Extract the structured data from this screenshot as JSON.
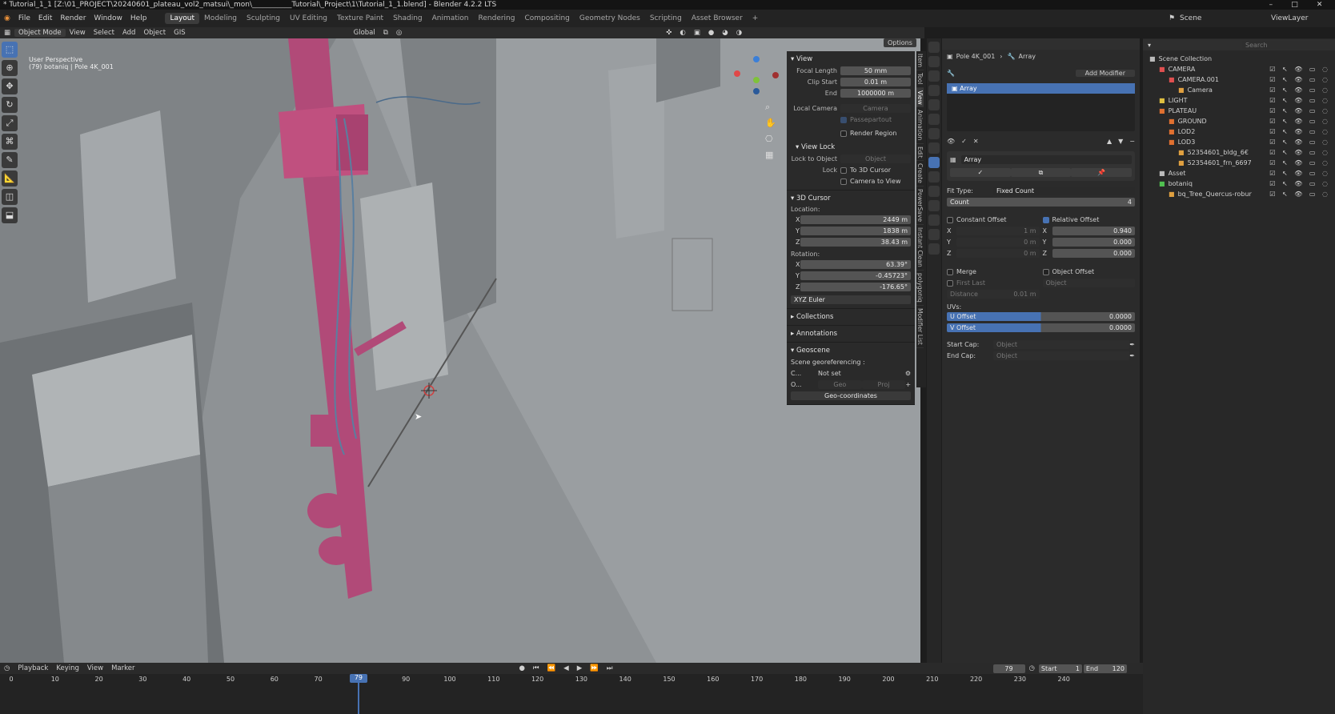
{
  "window": {
    "title": "* Tutorial_1_1 [Z:\\01_PROJECT\\20240601_plateau_vol2_matsui\\_mon\\___________Tutorial\\_Project\\1\\Tutorial_1_1.blend] - Blender 4.2.2 LTS"
  },
  "menu": [
    "File",
    "Edit",
    "Render",
    "Window",
    "Help"
  ],
  "workspaces": [
    {
      "label": "Layout",
      "active": true
    },
    {
      "label": "Modeling"
    },
    {
      "label": "Sculpting"
    },
    {
      "label": "UV Editing"
    },
    {
      "label": "Texture Paint"
    },
    {
      "label": "Shading"
    },
    {
      "label": "Animation"
    },
    {
      "label": "Rendering"
    },
    {
      "label": "Compositing"
    },
    {
      "label": "Geometry Nodes"
    },
    {
      "label": "Scripting"
    },
    {
      "label": "Asset Browser"
    },
    {
      "label": "+"
    }
  ],
  "scene": {
    "label": "Scene",
    "view_layer": "ViewLayer"
  },
  "vp_header": {
    "mode": "Object Mode",
    "view": "View",
    "select": "Select",
    "add": "Add",
    "object": "Object",
    "gis": "GIS",
    "transform": "Global",
    "options": "Options"
  },
  "viewport": {
    "line1": "User Perspective",
    "line2": "(79) botaniq | Pole 4K_001"
  },
  "tools": [
    "select",
    "cursor",
    "move",
    "rotate",
    "scale",
    "transform",
    "annotate",
    "measure",
    "add-cube",
    "extrude"
  ],
  "npanel": {
    "view": {
      "title": "View",
      "focal_label": "Focal Length",
      "focal": "50 mm",
      "clip_start_label": "Clip Start",
      "clip_start": "0.01 m",
      "end_label": "End",
      "end": "1000000 m",
      "local_camera_label": "Local Camera",
      "local_camera": "Camera",
      "passepartout": "Passepartout",
      "render_region": "Render Region"
    },
    "view_lock": {
      "title": "View Lock",
      "lock_to_object_label": "Lock to Object",
      "object_placeholder": "Object",
      "lock_label": "Lock",
      "to_3d_cursor": "To 3D Cursor",
      "camera_to_view": "Camera to View"
    },
    "cursor": {
      "title": "3D Cursor",
      "location_label": "Location:",
      "x": "2449 m",
      "y": "1838 m",
      "z": "38.43 m",
      "rotation_label": "Rotation:",
      "rx": "63.39°",
      "ry": "-0.45723°",
      "rz": "-176.65°",
      "mode": "XYZ Euler"
    },
    "collections": "Collections",
    "annotations": "Annotations",
    "geoscene": {
      "title": "Geoscene",
      "georef": "Scene georeferencing :",
      "c_label": "C...",
      "c_value": "Not set",
      "o_label": "O...",
      "geo": "Geo",
      "proj": "Proj",
      "geo_coords": "Geo-coordinates"
    }
  },
  "tabs": [
    "Item",
    "Tool",
    "View",
    "Animation",
    "Edit",
    "Create",
    "PowerSave",
    "Instant Clean",
    "polygoniq",
    "Modifier List"
  ],
  "properties": {
    "breadcrumb_obj": "Pole 4K_001",
    "breadcrumb_mod": "Array",
    "add_modifier": "Add Modifier",
    "stack_item": "Array",
    "mod_name": "Array",
    "fit_type_label": "Fit Type:",
    "fit_type": "Fixed Count",
    "count_label": "Count",
    "count": "4",
    "constant_offset": "Constant Offset",
    "cx": "1 m",
    "cy": "0 m",
    "cz": "0 m",
    "relative_offset": "Relative Offset",
    "rx": "0.940",
    "ry": "0.000",
    "rz": "0.000",
    "merge": "Merge",
    "first_last": "First Last",
    "distance_label": "Distance",
    "distance": "0.01 m",
    "object_offset": "Object Offset",
    "object_placeholder": "Object",
    "uvs_label": "UVs:",
    "u_offset_label": "U Offset",
    "u_offset": "0.0000",
    "v_offset_label": "V Offset",
    "v_offset": "0.0000",
    "start_cap_label": "Start Cap:",
    "end_cap_label": "End Cap:",
    "cap_placeholder": "Object"
  },
  "outliner": {
    "search": "Search",
    "rows": [
      {
        "label": "Scene Collection",
        "indent": 0,
        "color": "#bbbbbb"
      },
      {
        "label": "CAMERA",
        "indent": 1,
        "color": "#e05050"
      },
      {
        "label": "CAMERA.001",
        "indent": 2,
        "color": "#e05050"
      },
      {
        "label": "Camera",
        "indent": 3,
        "color": "#e0a040"
      },
      {
        "label": "LIGHT",
        "indent": 1,
        "color": "#e0c040"
      },
      {
        "label": "PLATEAU",
        "indent": 1,
        "color": "#e07030"
      },
      {
        "label": "GROUND",
        "indent": 2,
        "color": "#e07030"
      },
      {
        "label": "LOD2",
        "indent": 2,
        "color": "#e07030"
      },
      {
        "label": "LOD3",
        "indent": 2,
        "color": "#e07030"
      },
      {
        "label": "52354601_bldg_6€",
        "indent": 3,
        "color": "#e0a040"
      },
      {
        "label": "52354601_frn_6697",
        "indent": 3,
        "color": "#e0a040"
      },
      {
        "label": "Asset",
        "indent": 1,
        "color": "#bbbbbb"
      },
      {
        "label": "botaniq",
        "indent": 1,
        "color": "#50c050"
      },
      {
        "label": "bq_Tree_Quercus-robur",
        "indent": 2,
        "color": "#e0a040"
      }
    ]
  },
  "timeline": {
    "playback": "Playback",
    "keying": "Keying",
    "view": "View",
    "marker": "Marker",
    "current_frame": "79",
    "start_label": "Start",
    "start": "1",
    "end_label": "End",
    "end": "120",
    "playhead": "79",
    "ticks": [
      "0",
      "10",
      "20",
      "30",
      "40",
      "50",
      "60",
      "70",
      "80",
      "90",
      "100",
      "110",
      "120",
      "130",
      "140",
      "150",
      "160",
      "170",
      "180",
      "190",
      "200",
      "210",
      "220",
      "230",
      "240"
    ]
  }
}
